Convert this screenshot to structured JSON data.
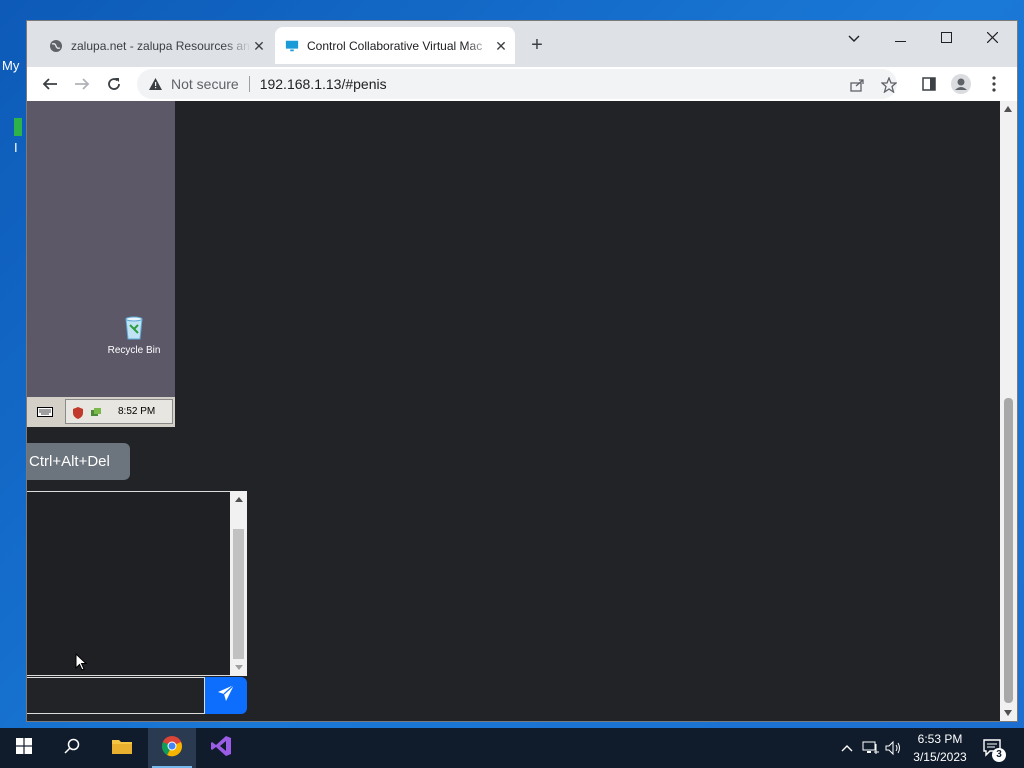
{
  "desktop": {
    "label_fragment_1": "My",
    "label_fragment_2": "I"
  },
  "browser": {
    "tabs": [
      {
        "title": "zalupa.net - zalupa Resources and",
        "active": false
      },
      {
        "title": "Control Collaborative Virtual Mac",
        "active": true
      }
    ],
    "omnibox": {
      "security_text": "Not secure",
      "url": "192.168.1.13/#penis"
    }
  },
  "vm": {
    "recycle_bin_label": "Recycle Bin",
    "clock": "8:52 PM"
  },
  "controls": {
    "ctrl_alt_del_label": "Ctrl+Alt+Del",
    "chat_input_value": ""
  },
  "taskbar": {
    "time": "6:53 PM",
    "date": "3/15/2023",
    "notification_count": "3"
  },
  "colors": {
    "vm_background": "#222326",
    "send_button": "#0d6efd",
    "cad_button": "#6c757d"
  }
}
